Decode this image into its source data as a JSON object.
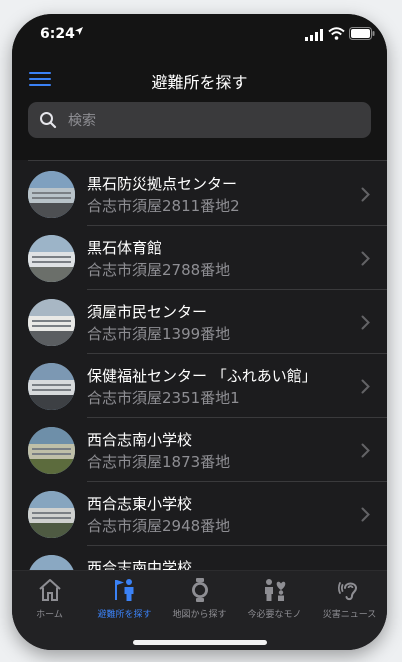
{
  "status": {
    "time": "6:24",
    "location_arrow": "location-arrow-icon"
  },
  "header": {
    "title": "避難所を探す"
  },
  "search": {
    "placeholder": "検索"
  },
  "shelters": [
    {
      "name": "黒石防災拠点センター",
      "address": "合志市須屋2811番地2"
    },
    {
      "name": "黒石体育館",
      "address": "合志市須屋2788番地"
    },
    {
      "name": "須屋市民センター",
      "address": "合志市須屋1399番地"
    },
    {
      "name": "保健福祉センター 「ふれあい館」",
      "address": "合志市須屋2351番地1"
    },
    {
      "name": "西合志南小学校",
      "address": "合志市須屋1873番地"
    },
    {
      "name": "西合志東小学校",
      "address": "合志市須屋2948番地"
    },
    {
      "name": "西合志南中学校",
      "address": ""
    }
  ],
  "tabs": [
    {
      "label": "ホーム",
      "icon": "home-icon"
    },
    {
      "label": "避難所を探す",
      "icon": "shelter-person-flag-icon"
    },
    {
      "label": "地図から探す",
      "icon": "map-watch-icon"
    },
    {
      "label": "今必要なモノ",
      "icon": "people-heart-icon"
    },
    {
      "label": "災害ニュース",
      "icon": "ear-hearing-icon"
    }
  ],
  "active_tab": 1,
  "colors": {
    "accent": "#3b82f6",
    "background": "#1c1c1e",
    "header": "#141414"
  }
}
